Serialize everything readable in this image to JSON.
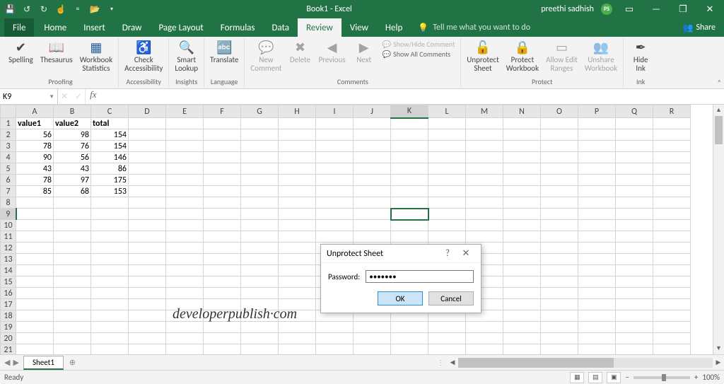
{
  "title": "Book1 - Excel",
  "user": {
    "name": "preethi sadhish",
    "initials": "PS"
  },
  "qat_icons": [
    "save",
    "undo",
    "redo",
    "touch-mode",
    "new-file",
    "open-folder"
  ],
  "tabs": [
    "File",
    "Home",
    "Insert",
    "Draw",
    "Page Layout",
    "Formulas",
    "Data",
    "Review",
    "View",
    "Help"
  ],
  "active_tab": "Review",
  "tellme_placeholder": "Tell me what you want to do",
  "share_label": "Share",
  "ribbon": {
    "proofing": {
      "label": "Proofing",
      "spelling": "Spelling",
      "thesaurus": "Thesaurus",
      "workbook_stats": "Workbook\nStatistics"
    },
    "accessibility": {
      "label": "Accessibility",
      "check": "Check\nAccessibility"
    },
    "insights": {
      "label": "Insights",
      "smart": "Smart\nLookup"
    },
    "language": {
      "label": "Language",
      "translate": "Translate"
    },
    "comments": {
      "label": "Comments",
      "new": "New\nComment",
      "delete": "Delete",
      "previous": "Previous",
      "next": "Next",
      "showhide": "Show/Hide Comment",
      "showall": "Show All Comments"
    },
    "protect": {
      "label": "Protect",
      "unprotect": "Unprotect\nSheet",
      "protect_wb": "Protect\nWorkbook",
      "allow_edit": "Allow Edit\nRanges",
      "unshare": "Unshare\nWorkbook"
    },
    "ink": {
      "label": "Ink",
      "hide": "Hide\nInk"
    }
  },
  "namebox": "K9",
  "columns": [
    "A",
    "B",
    "C",
    "D",
    "E",
    "F",
    "G",
    "H",
    "I",
    "J",
    "K",
    "L",
    "M",
    "N",
    "O",
    "P",
    "Q",
    "R"
  ],
  "rows": 21,
  "selected": {
    "col": "K",
    "row": 9
  },
  "data": {
    "headers": [
      "value1",
      "value2",
      "total"
    ],
    "values": [
      [
        56,
        98,
        154
      ],
      [
        78,
        76,
        154
      ],
      [
        90,
        56,
        146
      ],
      [
        43,
        43,
        86
      ],
      [
        78,
        97,
        175
      ],
      [
        85,
        68,
        153
      ]
    ]
  },
  "chart_data": {
    "type": "table",
    "title": "",
    "columns": [
      "value1",
      "value2",
      "total"
    ],
    "rows": [
      [
        56,
        98,
        154
      ],
      [
        78,
        76,
        154
      ],
      [
        90,
        56,
        146
      ],
      [
        43,
        43,
        86
      ],
      [
        78,
        97,
        175
      ],
      [
        85,
        68,
        153
      ]
    ]
  },
  "watermark": "developerpublish·com",
  "dialog": {
    "title": "Unprotect Sheet",
    "password_label": "Password:",
    "password_value": "•••••••",
    "ok": "OK",
    "cancel": "Cancel",
    "help": "?"
  },
  "sheettab": {
    "name": "Sheet1"
  },
  "status": {
    "ready": "Ready",
    "zoom": "100%"
  }
}
